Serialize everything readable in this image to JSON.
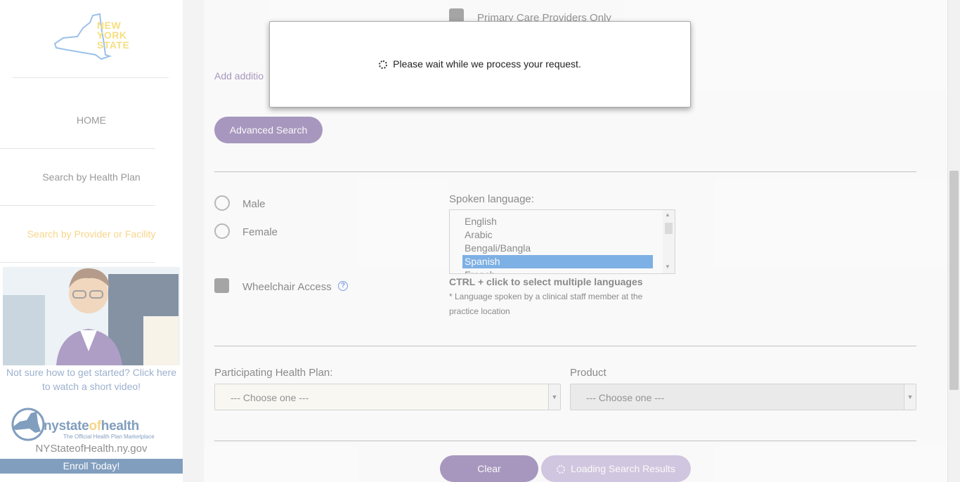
{
  "sidebar": {
    "logo_text": [
      "NEW",
      "YORK",
      "STATE"
    ],
    "nav": [
      {
        "label": "HOME",
        "active": false
      },
      {
        "label": "Search by Health Plan",
        "active": false
      },
      {
        "label": "Search by Provider or Facility",
        "active": true
      }
    ],
    "video_caption": "Not sure how to get started? Click here to watch a short video!",
    "nysoh": {
      "name_left": "nystate",
      "name_mid": "of",
      "name_right": "health",
      "tagline": "The Official Health Plan Marketplace",
      "url": "NYStateofHealth.ny.gov",
      "enroll": "Enroll Today!"
    }
  },
  "main": {
    "primary_care_label": "Primary Care Providers Only",
    "add_additional_link": "Add additio",
    "advanced_search_button": "Advanced Search",
    "gender": {
      "male": "Male",
      "female": "Female"
    },
    "wheelchair_label": "Wheelchair Access",
    "help_icon_glyph": "?",
    "spoken_language": {
      "label": "Spoken language:",
      "options": [
        "English",
        "Arabic",
        "Bengali/Bangla",
        "Spanish",
        "French"
      ],
      "selected": "Spanish",
      "hint": "CTRL + click to select multiple languages",
      "footnote": "* Language spoken by a clinical staff member at the practice location"
    },
    "health_plan": {
      "label": "Participating Health Plan:",
      "value": "--- Choose one ---"
    },
    "product": {
      "label": "Product",
      "value": "--- Choose one ---"
    },
    "clear_button": "Clear",
    "loading_button": "Loading Search Results"
  },
  "modal": {
    "message": "Please wait while we process your request."
  },
  "colors": {
    "accent_purple": "#6a4c93",
    "active_nav": "#f0b429",
    "selected_option": "#1e7bd8",
    "brand_blue": "#1b4f8a"
  }
}
